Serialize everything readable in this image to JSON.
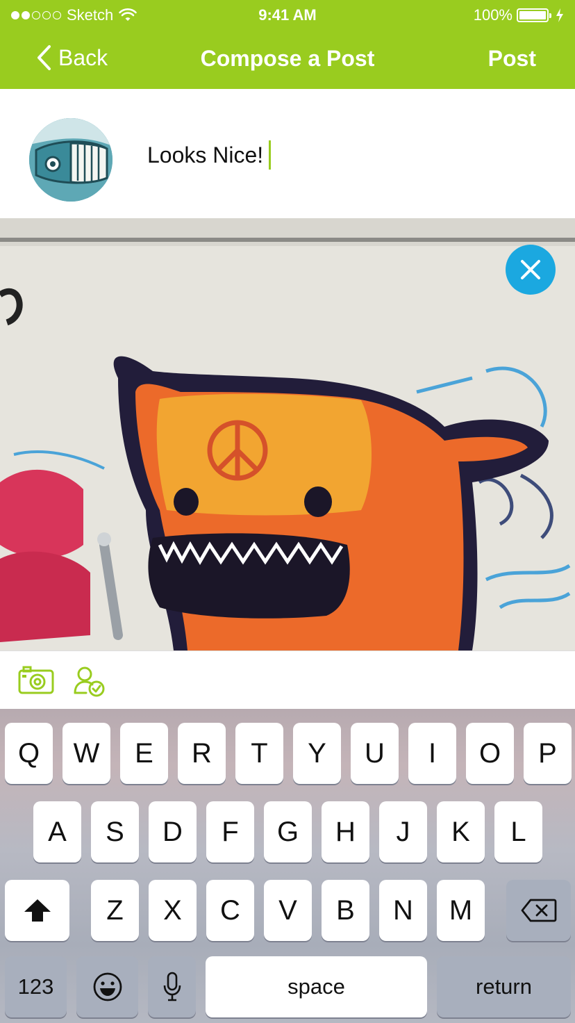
{
  "status_bar": {
    "carrier": "Sketch",
    "time": "9:41 AM",
    "battery": "100%",
    "signal_bars": 2
  },
  "nav": {
    "back_label": "Back",
    "title": "Compose a Post",
    "post_label": "Post"
  },
  "compose": {
    "text": "Looks Nice!"
  },
  "icons": {
    "back": "chevron-left-icon",
    "wifi": "wifi-icon",
    "battery": "battery-icon",
    "charging": "bolt-icon",
    "remove_photo": "close-icon",
    "camera": "camera-icon",
    "tag_user": "user-check-icon",
    "shift": "shift-arrow-icon",
    "delete": "backspace-icon",
    "emoji": "smiley-icon",
    "dictation": "microphone-icon"
  },
  "colors": {
    "brand": "#99cc1f",
    "remove_button": "#1ba8e0"
  },
  "keyboard": {
    "row1": [
      "Q",
      "W",
      "E",
      "R",
      "T",
      "Y",
      "U",
      "I",
      "O",
      "P"
    ],
    "row2": [
      "A",
      "S",
      "D",
      "F",
      "G",
      "H",
      "J",
      "K",
      "L"
    ],
    "row3": [
      "Z",
      "X",
      "C",
      "V",
      "B",
      "N",
      "M"
    ],
    "numbers_label": "123",
    "space_label": "space",
    "return_label": "return"
  }
}
